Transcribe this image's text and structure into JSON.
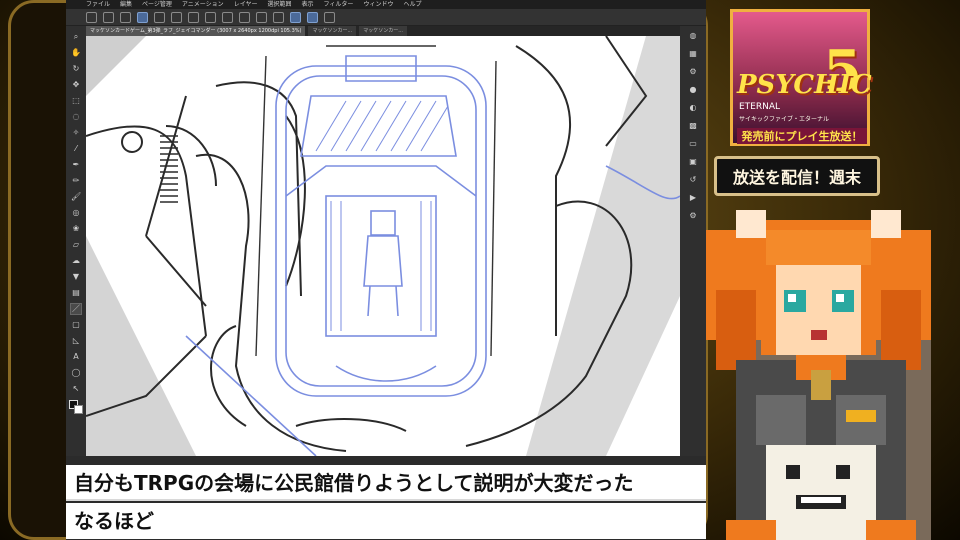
{
  "menubar": {
    "items": [
      "ファイル",
      "編集",
      "ページ管理",
      "アニメーション",
      "レイヤー",
      "選択範囲",
      "表示",
      "フィルター",
      "ウィンドウ",
      "ヘルプ"
    ]
  },
  "document_tabs": [
    {
      "label": "マッケソンカードゲーム_第3弾_ラフ_ジェイコマンダー (3007 x 2640px 1200dpi 105.3%)",
      "active": true
    },
    {
      "label": "マッケソンカー...",
      "active": false
    },
    {
      "label": "マッケソンカー...",
      "active": false
    }
  ],
  "tools": [
    {
      "name": "zoom-tool-icon",
      "glyph": "⌕"
    },
    {
      "name": "hand-tool-icon",
      "glyph": "✋"
    },
    {
      "name": "rotate-tool-icon",
      "glyph": "↻"
    },
    {
      "name": "move-tool-icon",
      "glyph": "✥"
    },
    {
      "name": "select-tool-icon",
      "glyph": "⬚"
    },
    {
      "name": "lasso-tool-icon",
      "glyph": "◌"
    },
    {
      "name": "magic-wand-icon",
      "glyph": "✧"
    },
    {
      "name": "eyedropper-icon",
      "glyph": "⁄"
    },
    {
      "name": "pen-tool-icon",
      "glyph": "✒"
    },
    {
      "name": "pencil-tool-icon",
      "glyph": "✏"
    },
    {
      "name": "brush-tool-icon",
      "glyph": "🖌"
    },
    {
      "name": "airbrush-tool-icon",
      "glyph": "◎"
    },
    {
      "name": "decoration-tool-icon",
      "glyph": "❀"
    },
    {
      "name": "eraser-tool-icon",
      "glyph": "▱"
    },
    {
      "name": "blend-tool-icon",
      "glyph": "☁"
    },
    {
      "name": "fill-tool-icon",
      "glyph": "▼"
    },
    {
      "name": "gradient-tool-icon",
      "glyph": "▤"
    },
    {
      "name": "figure-tool-icon",
      "glyph": "／"
    },
    {
      "name": "frame-tool-icon",
      "glyph": "▢"
    },
    {
      "name": "ruler-tool-icon",
      "glyph": "◺"
    },
    {
      "name": "text-tool-icon",
      "glyph": "A"
    },
    {
      "name": "balloon-tool-icon",
      "glyph": "◯"
    },
    {
      "name": "correct-line-tool-icon",
      "glyph": "↖"
    }
  ],
  "right_icons": [
    "navigator-icon",
    "layers-icon",
    "properties-icon",
    "brush-size-icon",
    "color-wheel-icon",
    "color-set-icon",
    "sub-view-icon",
    "material-icon",
    "history-icon",
    "auto-actions-icon",
    "settings-icon"
  ],
  "comments": {
    "line1": "自分もTRPGの会場に公民館借りようとして説明が大変だった",
    "line2": "なるほど"
  },
  "promo": {
    "title": "PSYCHIC",
    "number": "5",
    "subtitle": "ETERNAL",
    "kana": "サイキックファイブ・エターナル",
    "caption": "発売前にプレイ生放送！"
  },
  "ticker": {
    "text": "放送を配信！週末"
  },
  "colors": {
    "frame_gold": "#8a6a24",
    "sketch_blue": "#7b8ee0",
    "ui_dark": "#2b2b2b",
    "hair_orange": "#ef7a1e"
  }
}
